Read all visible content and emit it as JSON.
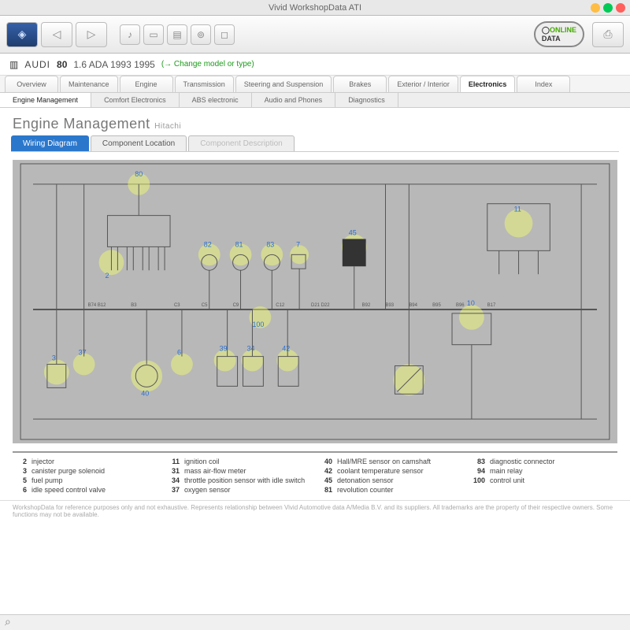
{
  "window": {
    "title": "Vivid WorkshopData ATI"
  },
  "vehicle": {
    "make": "AUDI",
    "model": "80",
    "details": "1.6 ADA 1993 1995",
    "change_link": "(→ Change model or type)"
  },
  "main_tabs": [
    "Overview",
    "Maintenance",
    "Engine",
    "Transmission",
    "Steering and Suspension",
    "Brakes",
    "Exterior / Interior",
    "Electronics",
    "Index"
  ],
  "main_tab_active": 7,
  "sub_tabs": [
    "Engine Management",
    "Comfort Electronics",
    "ABS electronic",
    "Audio and Phones",
    "Diagnostics"
  ],
  "sub_tab_active": 0,
  "page": {
    "heading": "Engine Management",
    "sub": "Hitachi"
  },
  "content_tabs": {
    "items": [
      "Wiring Diagram",
      "Component Location",
      "Component Description"
    ],
    "active": 0,
    "disabled": 2
  },
  "legend_rows": [
    [
      "2",
      "injector",
      "11",
      "ignition coil",
      "40",
      "Hall/MRE sensor on camshaft",
      "83",
      "diagnostic connector"
    ],
    [
      "3",
      "canister purge solenoid",
      "31",
      "mass air-flow meter",
      "42",
      "coolant temperature sensor",
      "94",
      "main relay"
    ],
    [
      "5",
      "fuel pump",
      "34",
      "throttle position sensor with idle switch",
      "45",
      "detonation sensor",
      "100",
      "control unit"
    ],
    [
      "6",
      "idle speed control valve",
      "37",
      "oxygen sensor",
      "81",
      "revolution counter",
      "",
      ""
    ]
  ],
  "diagram": {
    "callouts": [
      "80",
      "2",
      "82",
      "81",
      "83",
      "7",
      "45",
      "11",
      "10",
      "3",
      "37",
      "40",
      "6",
      "39",
      "34",
      "42",
      "100"
    ],
    "pins": [
      "B74 B12",
      "B3",
      "C3",
      "C5",
      "C9",
      "C12",
      "D21 D22",
      "B92",
      "B93",
      "B94",
      "B95",
      "B96",
      "B17"
    ]
  },
  "footnote": "WorkshopData for reference purposes only and not exhaustive. Represents relationship between Vivid Automotive data A/Media B.V. and its suppliers. All trademarks are the property of their respective owners. Some functions may not be available."
}
